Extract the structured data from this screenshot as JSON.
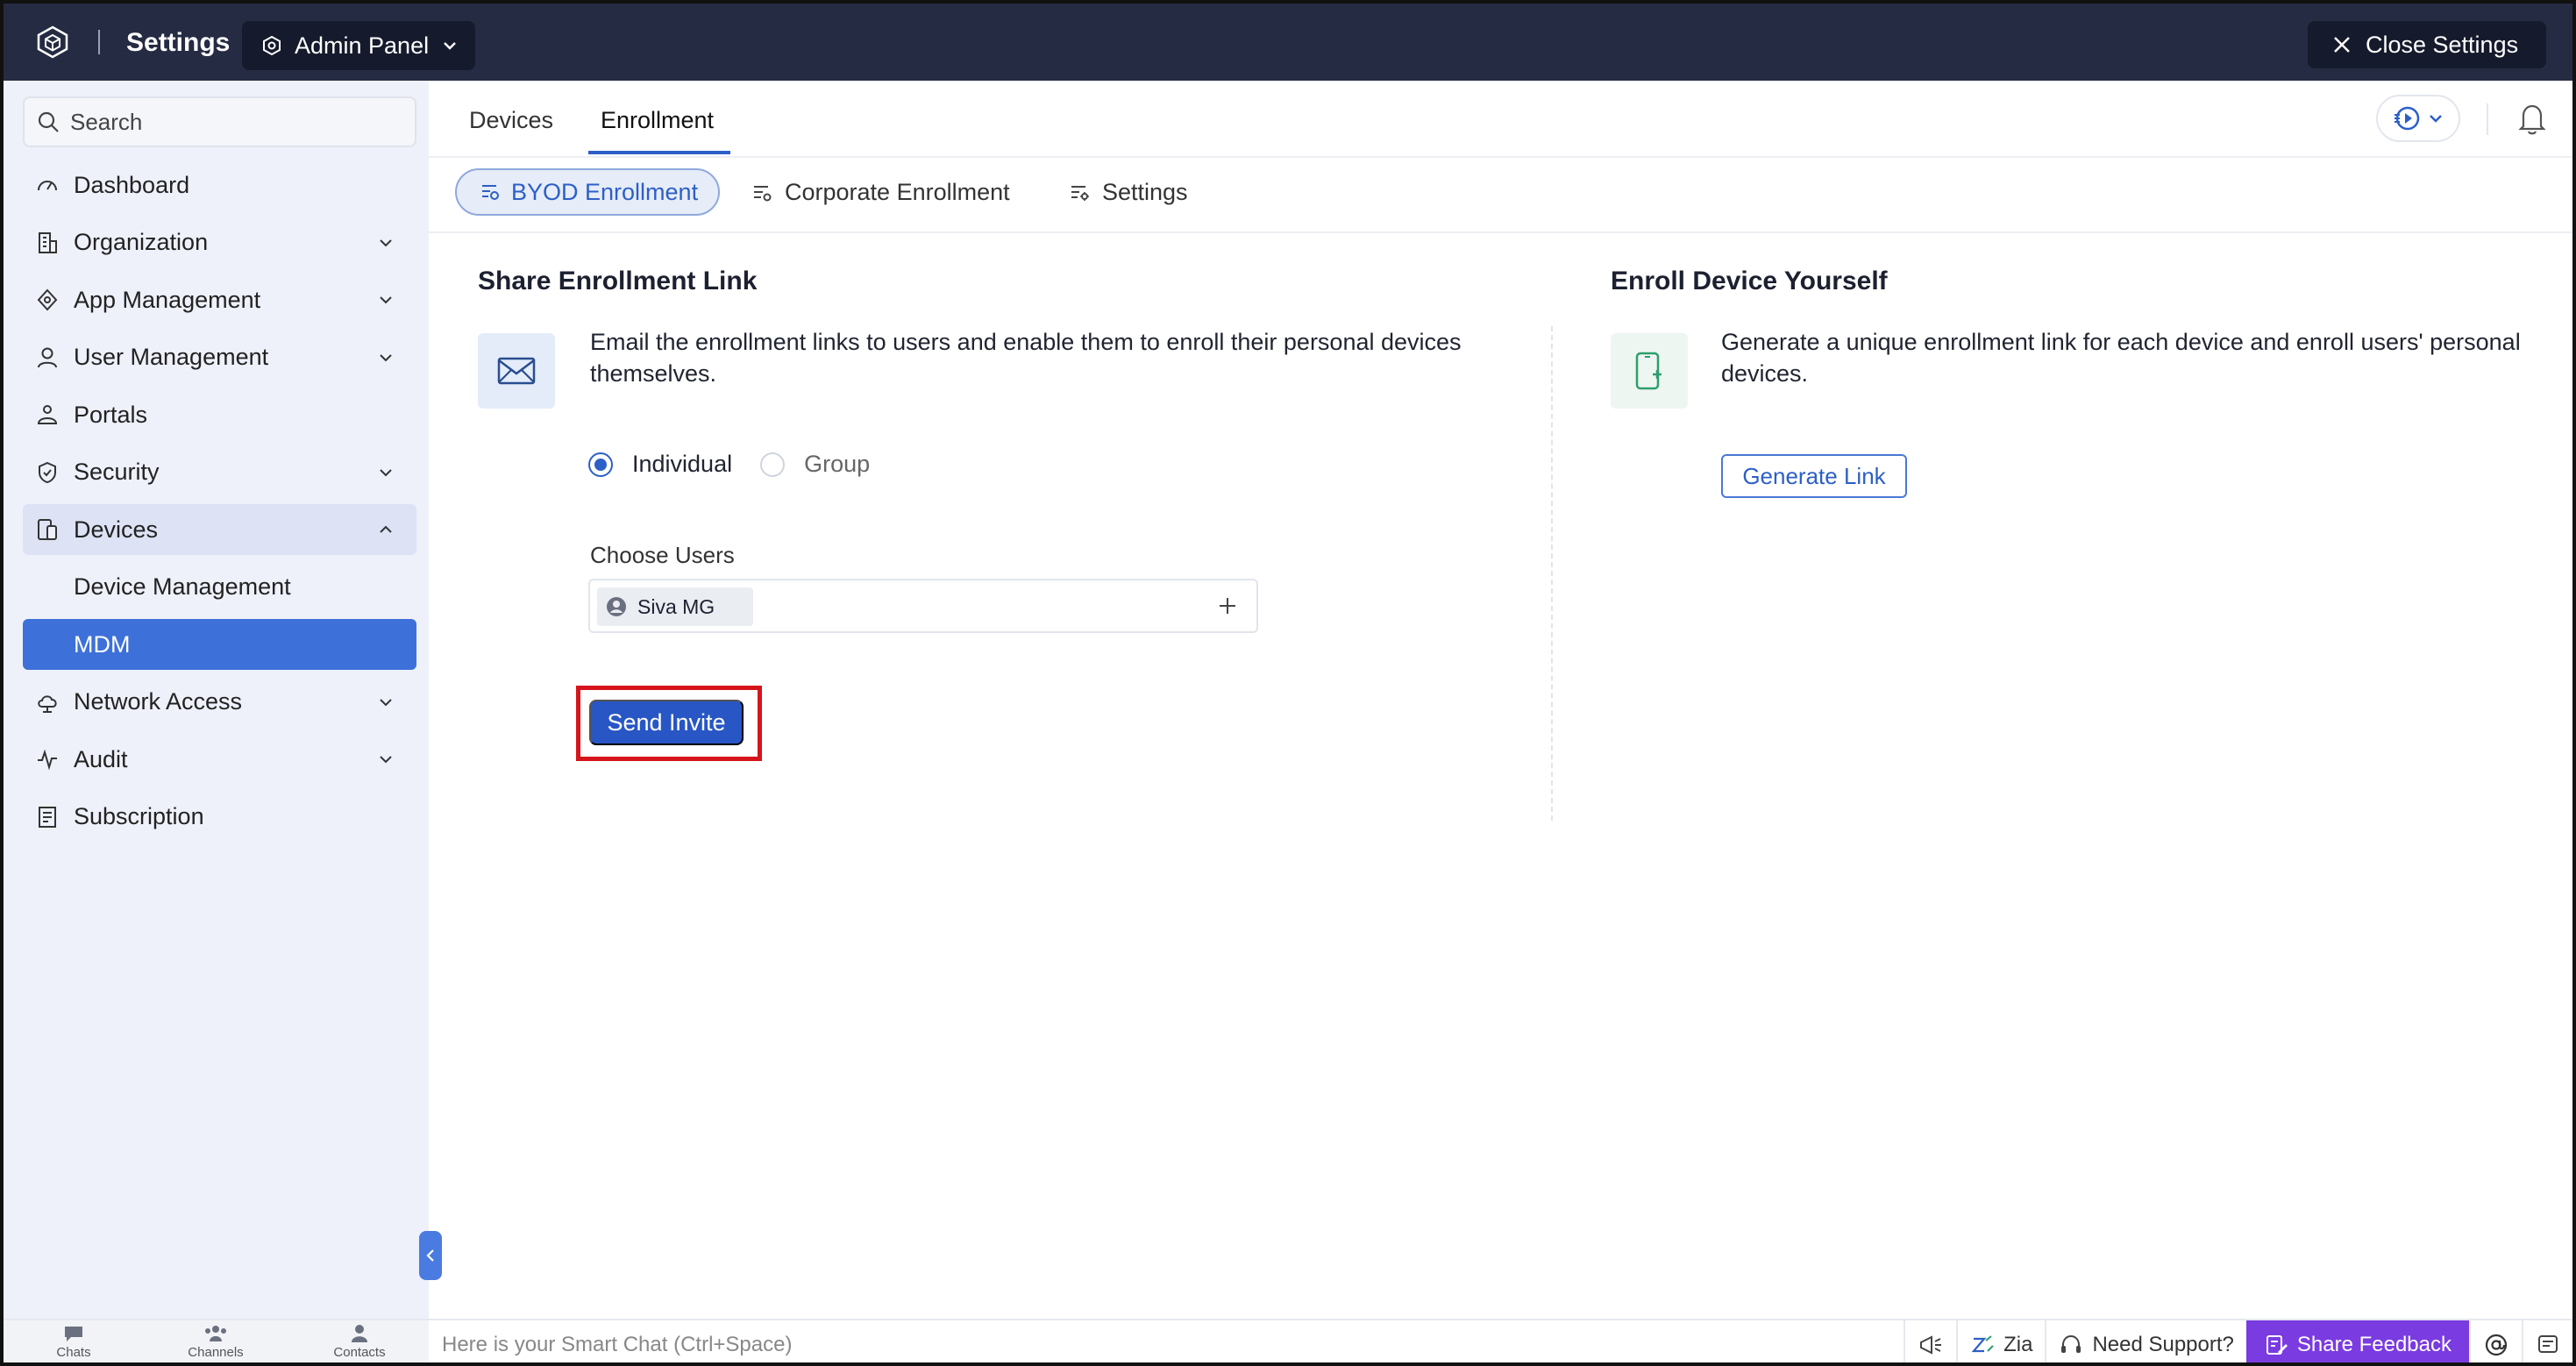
{
  "header": {
    "app_title": "Settings",
    "admin_panel_label": "Admin Panel",
    "close_label": "Close Settings"
  },
  "sidebar": {
    "search_placeholder": "Search",
    "items": [
      {
        "label": "Dashboard",
        "icon": "dashboard-icon"
      },
      {
        "label": "Organization",
        "icon": "organization-icon"
      },
      {
        "label": "App Management",
        "icon": "app-management-icon"
      },
      {
        "label": "User Management",
        "icon": "user-icon"
      },
      {
        "label": "Portals",
        "icon": "portals-icon"
      },
      {
        "label": "Security",
        "icon": "shield-icon"
      },
      {
        "label": "Devices",
        "icon": "devices-icon"
      },
      {
        "label": "Device Management"
      },
      {
        "label": "MDM"
      },
      {
        "label": "Network Access",
        "icon": "cloud-icon"
      },
      {
        "label": "Audit",
        "icon": "pulse-icon"
      },
      {
        "label": "Subscription",
        "icon": "document-icon"
      }
    ]
  },
  "tabs": [
    "Devices",
    "Enrollment"
  ],
  "subtabs": [
    "BYOD Enrollment",
    "Corporate Enrollment",
    "Settings"
  ],
  "share": {
    "title": "Share Enrollment Link",
    "desc_line1": "Email the enrollment links to users and enable them to enroll their personal devices",
    "desc_line2": "themselves.",
    "radio_individual": "Individual",
    "radio_group": "Group",
    "choose_users_label": "Choose Users",
    "selected_user": "Siva MG",
    "send_label": "Send Invite"
  },
  "enroll_self": {
    "title": "Enroll Device Yourself",
    "desc_line1": "Generate a unique enrollment link for each device and enroll users' personal",
    "desc_line2": "devices.",
    "generate_label": "Generate Link"
  },
  "bottom": {
    "chats": "Chats",
    "channels": "Channels",
    "contacts": "Contacts",
    "smart_chat": "Here is your Smart Chat (Ctrl+Space)",
    "zia": "Zia",
    "need_support": "Need Support?",
    "share_feedback": "Share Feedback"
  },
  "colors": {
    "topbar": "#252b42",
    "accent": "#2c5fc7",
    "active_nav": "#3d70d9",
    "highlight_outline": "#d6141c",
    "feedback": "#7a3be0"
  }
}
